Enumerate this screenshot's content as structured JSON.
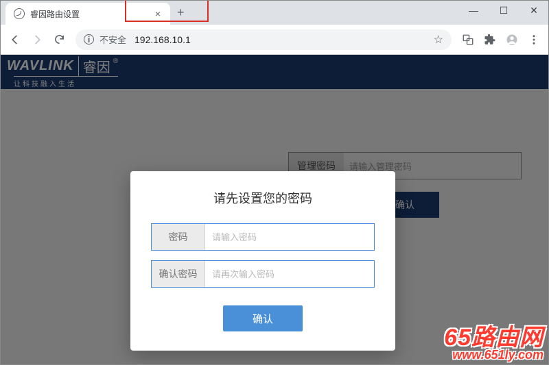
{
  "browser": {
    "tab_title": "睿因路由设置",
    "insecure_label": "不安全",
    "url": "192.168.10.1"
  },
  "brand": {
    "logo_en": "WAVLINK",
    "logo_cn": "睿因",
    "tagline": "让科技融入生活"
  },
  "background_panel": {
    "admin_label": "管理密码",
    "admin_placeholder": "请输入管理密码",
    "confirm_button": "确认"
  },
  "modal": {
    "title": "请先设置您的密码",
    "password_label": "密码",
    "password_placeholder": "请输入密码",
    "confirm_label": "确认密码",
    "confirm_placeholder": "请再次输入密码",
    "submit": "确认"
  },
  "watermark": {
    "brand": "65路由网",
    "url": "www.651ly.com"
  }
}
